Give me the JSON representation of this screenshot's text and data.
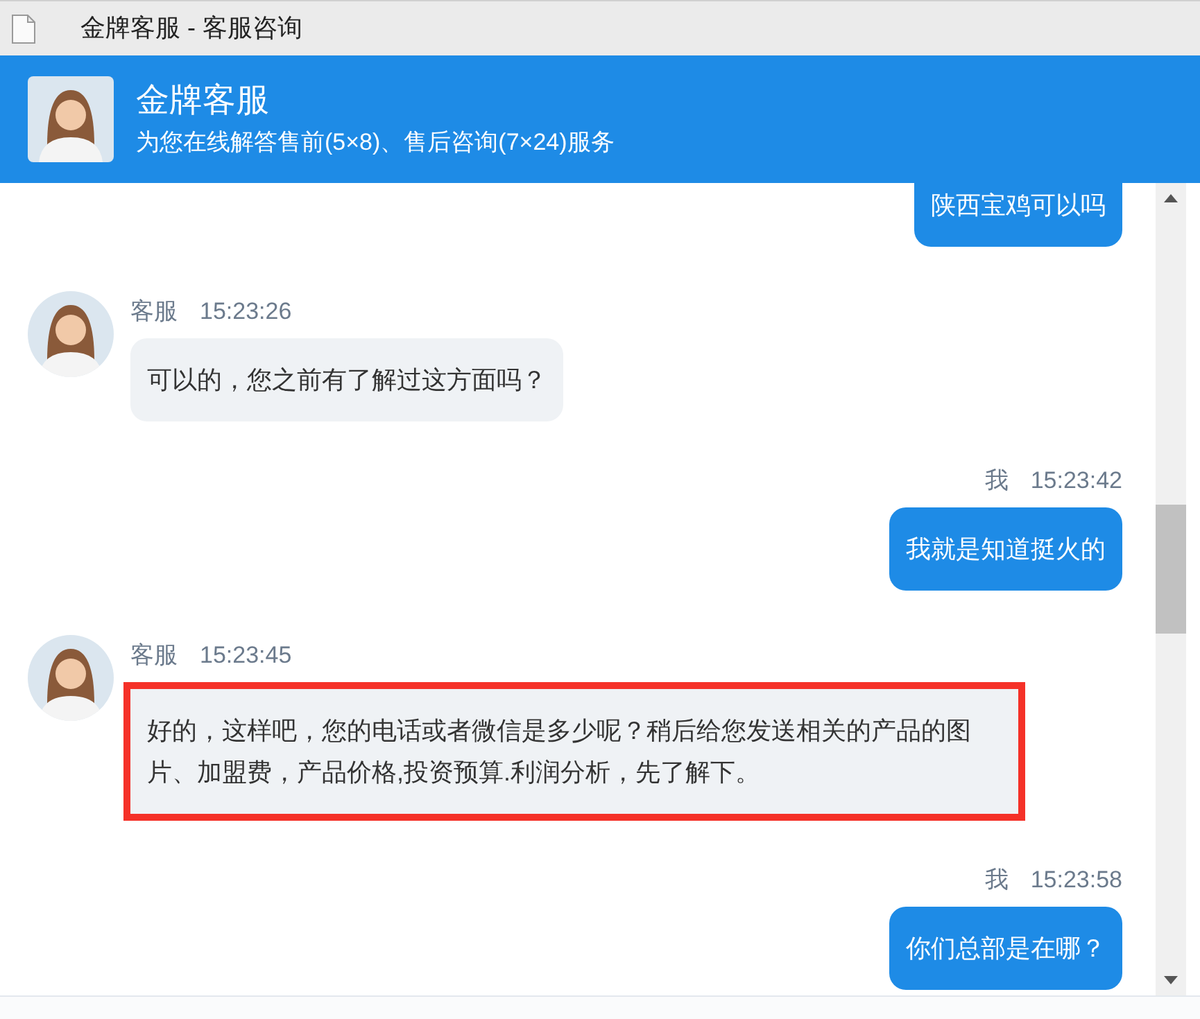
{
  "window": {
    "title": "金牌客服 - 客服咨询"
  },
  "header": {
    "name": "金牌客服",
    "subtitle": "为您在线解答售前(5×8)、售后咨询(7×24)服务"
  },
  "messages": [
    {
      "kind": "user",
      "text": "陕西宝鸡可以吗",
      "highlighted": false
    },
    {
      "kind": "agent",
      "sender": "客服",
      "time": "15:23:26",
      "text": "可以的，您之前有了解过这方面吗？",
      "highlighted": false
    },
    {
      "kind": "user",
      "sender": "我",
      "time": "15:23:42",
      "text": "我就是知道挺火的",
      "highlighted": false
    },
    {
      "kind": "agent",
      "sender": "客服",
      "time": "15:23:45",
      "text": "好的，这样吧，您的电话或者微信是多少呢？稍后给您发送相关的产品的图片、加盟费，产品价格,投资预算.利润分析，先了解下。",
      "highlighted": true
    },
    {
      "kind": "user",
      "sender": "我",
      "time": "15:23:58",
      "text": "你们总部是在哪？",
      "highlighted": false
    }
  ]
}
